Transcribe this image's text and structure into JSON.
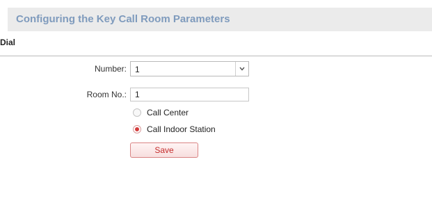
{
  "header": {
    "title": "Configuring the Key Call Room Parameters"
  },
  "section": {
    "title": "Dial"
  },
  "form": {
    "number_label": "Number:",
    "number_value": "1",
    "room_label": "Room No.:",
    "room_value": "1",
    "radio_options": [
      {
        "label": "Call Center",
        "checked": false
      },
      {
        "label": "Call Indoor Station",
        "checked": true
      }
    ],
    "save_label": "Save"
  },
  "icons": {
    "dropdown": "chevron-down-icon"
  },
  "colors": {
    "title_text": "#7f9bbd",
    "title_bar": "#ebebeb",
    "accent_red": "#d43c3c"
  }
}
